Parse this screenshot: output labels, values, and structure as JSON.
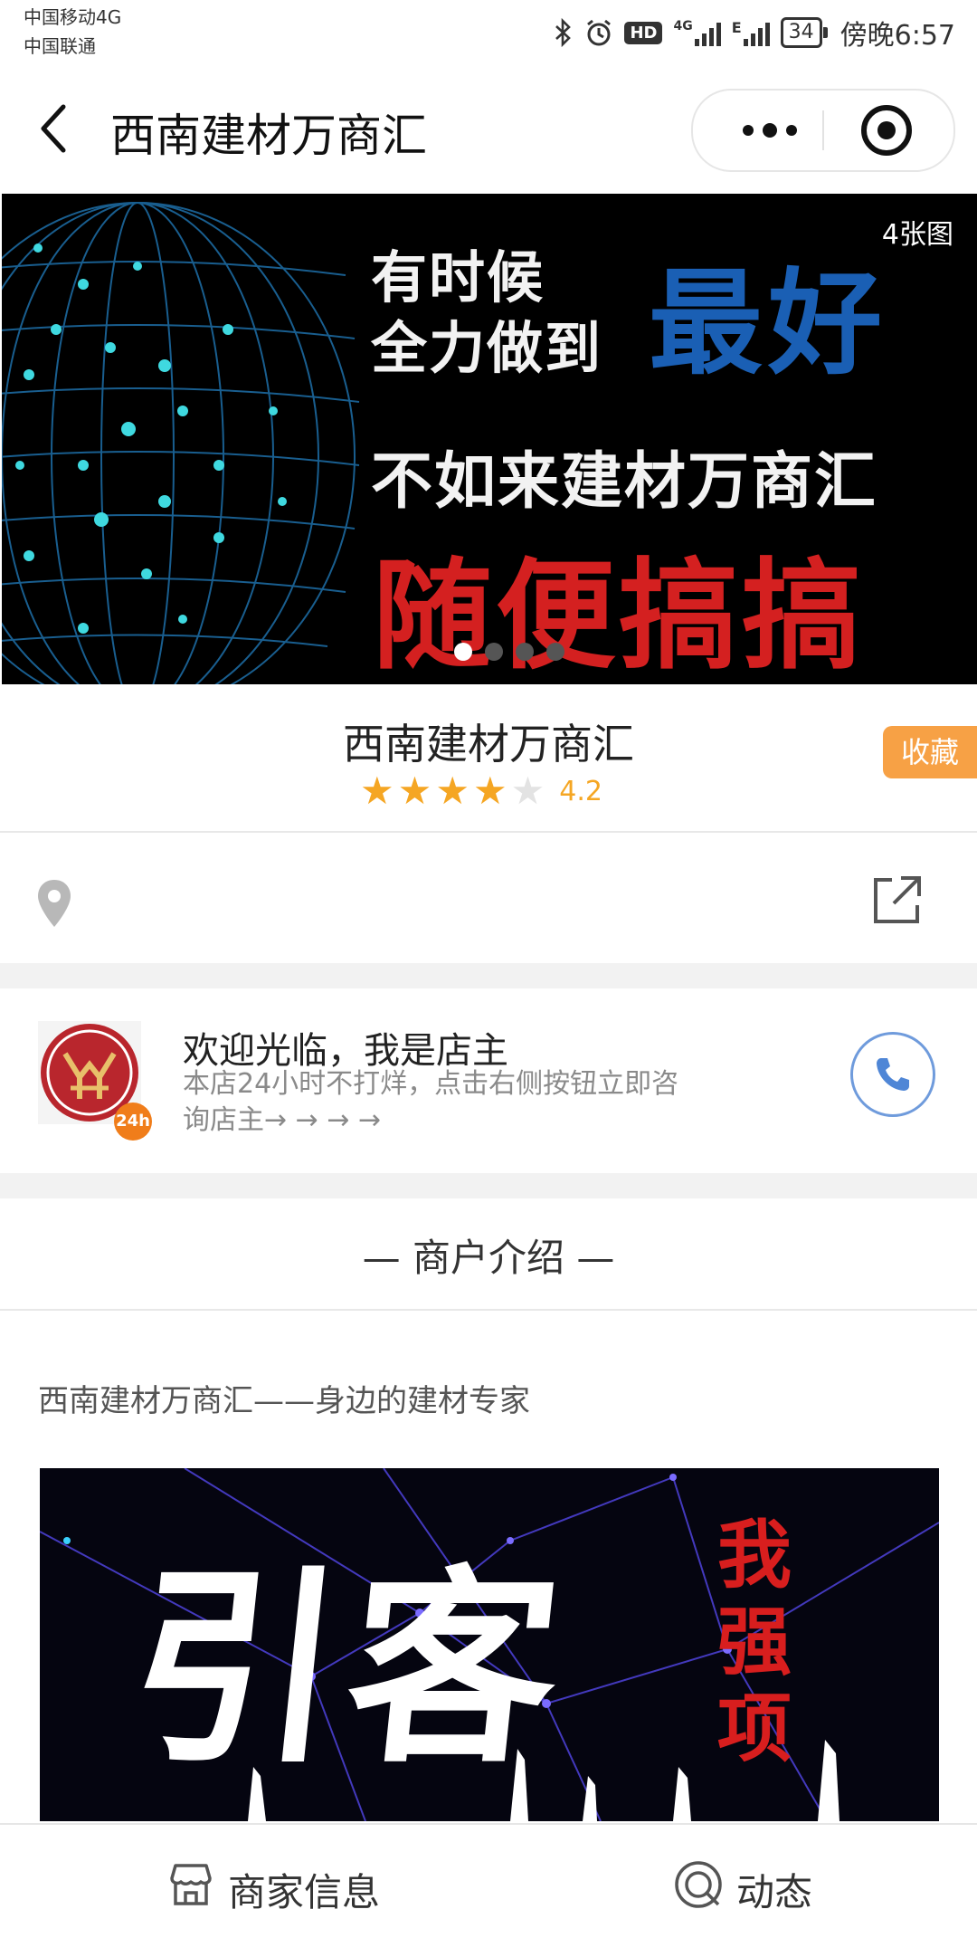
{
  "status_bar": {
    "carrier1": "中国移动4G",
    "carrier2": "中国联通",
    "network1": "4G",
    "network2": "E",
    "battery": "34",
    "time": "傍晚6:57"
  },
  "nav": {
    "title": "西南建材万商汇",
    "back_icon": "chevron-left-icon",
    "more_icon": "more-dots-icon",
    "close_icon": "miniprogram-close-icon"
  },
  "banner": {
    "count_label": "4张图",
    "line1": "有时候",
    "line2": "全力做到",
    "highlight": "最好",
    "line3": "不如来建材万商汇",
    "red_text": "随便搞搞",
    "active_dot": 1
  },
  "shop": {
    "name": "西南建材万商汇",
    "rating": 4.2,
    "rating_text": "4.2",
    "stars_filled": 4,
    "stars_total": 5,
    "favorite_label": "收藏",
    "favorite_color": "#f7a145",
    "rating_color": "#f5a623"
  },
  "location": {
    "pin_icon": "location-pin-icon",
    "share_icon": "external-link-icon"
  },
  "owner": {
    "welcome": "欢迎光临，我是店主",
    "desc": "本店24小时不打烊，点击右侧按钮立即咨询店主→ → → →",
    "badge": "24h",
    "call_icon": "phone-icon"
  },
  "intro": {
    "title": "— 商户介绍 —",
    "text": "西南建材万商汇——身边的建材专家",
    "promo_big": "引客",
    "promo_side": "我强项"
  },
  "tabbar": {
    "tab1_label": "商家信息",
    "tab1_icon": "store-icon",
    "tab2_label": "动态",
    "tab2_icon": "moments-icon"
  }
}
